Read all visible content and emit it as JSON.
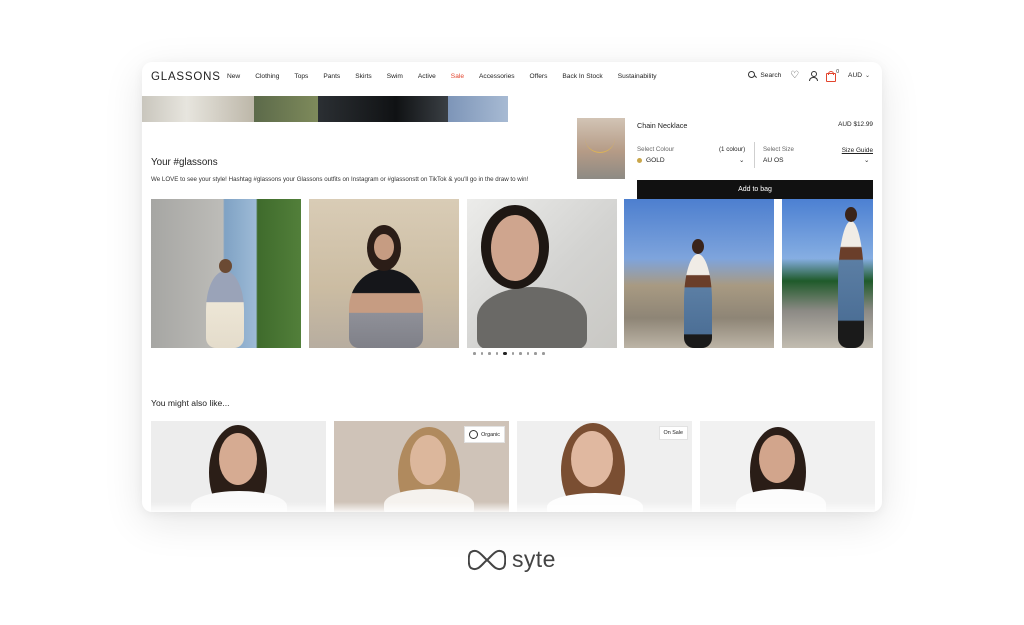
{
  "header": {
    "logo": "GLASSONS",
    "nav": [
      "New",
      "Clothing",
      "Tops",
      "Pants",
      "Skirts",
      "Swim",
      "Active",
      "Sale",
      "Accessories",
      "Offers",
      "Back In Stock",
      "Sustainability"
    ],
    "search_label": "Search",
    "cart_count": "0",
    "currency": "AUD",
    "sale_color": "#e2452e"
  },
  "product": {
    "name": "Chain Necklace",
    "price": "AUD $12.99",
    "colour_label": "Select Colour",
    "colour_count": "(1 colour)",
    "colour_value": "GOLD",
    "size_label": "Select Size",
    "size_guide": "Size Guide",
    "size_value": "AU OS",
    "add_to_bag": "Add to bag"
  },
  "hashtag": {
    "title": "Your #glassons",
    "description": "We LOVE to see your style! Hashtag #glassons your Glassons outfits on Instagram or #glassonstt on TikTok & you'll go in the draw to win!",
    "carousel_pages": 10,
    "carousel_active_page": 5
  },
  "recommendations": {
    "title": "You might also like...",
    "badges": {
      "organic": "Organic",
      "on_sale": "On Sale"
    }
  },
  "brand": {
    "name": "syte"
  }
}
